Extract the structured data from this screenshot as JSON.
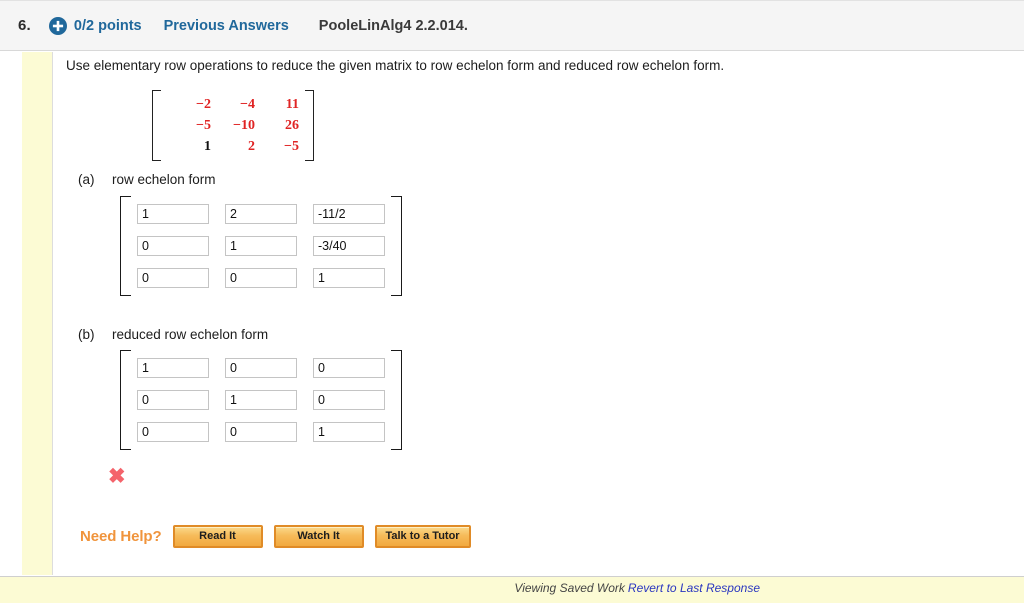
{
  "header": {
    "question_number": "6.",
    "plus_icon": "plus-circle-icon",
    "points": "0/2 points",
    "previous_answers": "Previous Answers",
    "book_tag": "PooleLinAlg4 2.2.014.",
    "accent_blue": "#20689b",
    "background": "#f5f5f5"
  },
  "prompt": "Use elementary row operations to reduce the given matrix to row echelon form and reduced row echelon form.",
  "given_matrix": {
    "rows": [
      [
        {
          "value": "−2",
          "color": "red"
        },
        {
          "value": "−4",
          "color": "red"
        },
        {
          "value": "11",
          "color": "red"
        }
      ],
      [
        {
          "value": "−5",
          "color": "red"
        },
        {
          "value": "−10",
          "color": "red"
        },
        {
          "value": "26",
          "color": "red"
        }
      ],
      [
        {
          "value": "1",
          "color": "black"
        },
        {
          "value": "2",
          "color": "red"
        },
        {
          "value": "−5",
          "color": "red"
        }
      ]
    ],
    "red_hex": "#e02424",
    "black_hex": "#111111"
  },
  "parts": [
    {
      "tag": "(a)",
      "label": "row echelon form",
      "values": [
        [
          "1",
          "2",
          "-11/2"
        ],
        [
          "0",
          "1",
          "-3/40"
        ],
        [
          "0",
          "0",
          "1"
        ]
      ]
    },
    {
      "tag": "(b)",
      "label": "reduced row echelon form",
      "values": [
        [
          "1",
          "0",
          "0"
        ],
        [
          "0",
          "1",
          "0"
        ],
        [
          "0",
          "0",
          "1"
        ]
      ]
    }
  ],
  "feedback": {
    "mark": "✖",
    "mark_name": "incorrect-x-icon",
    "color": "#f4636b"
  },
  "need_help": {
    "label": "Need Help?",
    "label_color": "#f0943c",
    "buttons": [
      "Read It",
      "Watch It",
      "Talk to a Tutor"
    ]
  },
  "footer": {
    "status": "Viewing Saved Work",
    "link": "Revert to Last Response",
    "link_color": "#2a36c0",
    "band_color": "#fcfbd4"
  }
}
